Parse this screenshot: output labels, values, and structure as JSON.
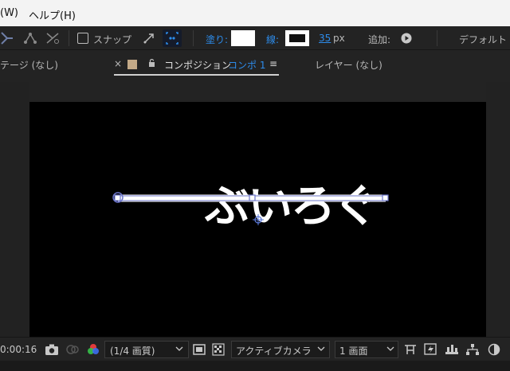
{
  "menubar": {
    "items": [
      "(W)",
      "ヘルプ(H)"
    ]
  },
  "toolbar": {
    "snap_label": "スナップ",
    "fill_label": "塗り:",
    "stroke_label": "線:",
    "stroke_width_value": "35",
    "stroke_width_unit": "px",
    "add_label": "追加:",
    "workspace_label": "デフォルト"
  },
  "tabs": {
    "footage_tab": "テージ (なし)",
    "close_symbol": "×",
    "composition_prefix": "コンポジション",
    "composition_name": "コンポ 1",
    "menu_symbol": "≡",
    "layer_tab": "レイヤー (なし)"
  },
  "composition": {
    "text_content": "ぶいろぐ"
  },
  "bottombar": {
    "timecode": "0:00:16",
    "resolution_value": "(1/4 画質)",
    "camera_value": "アクティブカメラ",
    "view_value": "1 画面"
  },
  "colors": {
    "accent_blue": "#2d8ceb",
    "comp_label_color": "#c3a987",
    "canvas_black": "#000000"
  }
}
